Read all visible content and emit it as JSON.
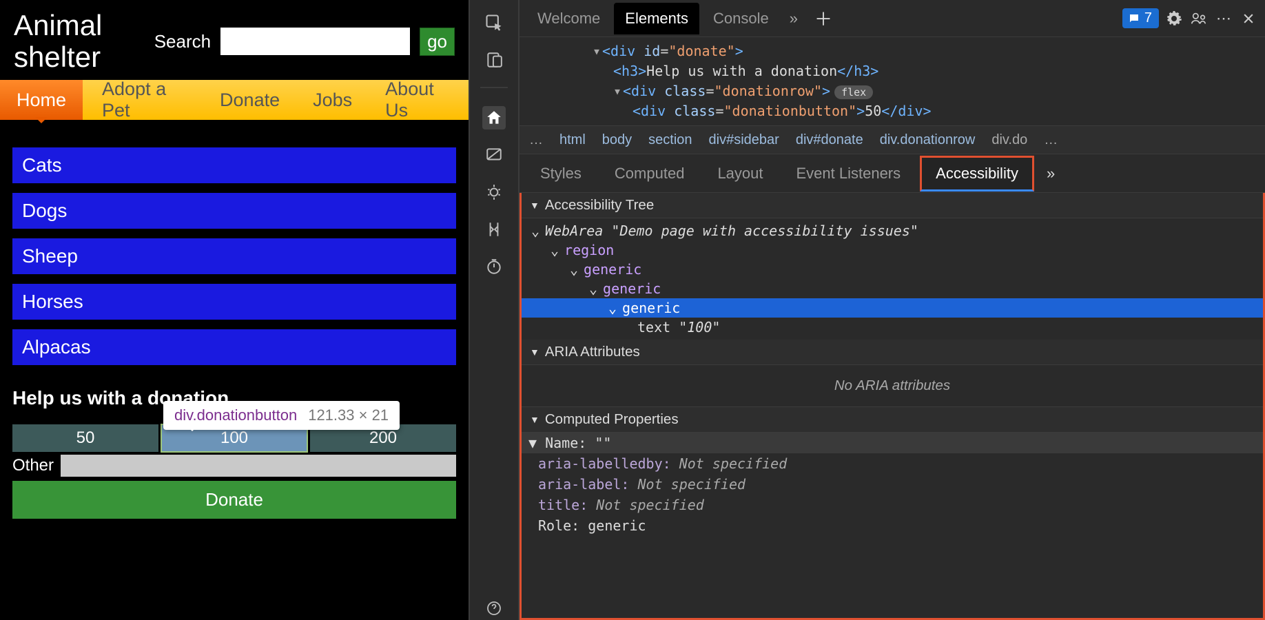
{
  "page": {
    "logo_line1": "Animal",
    "logo_line2": "shelter",
    "search_label": "Search",
    "go_label": "go",
    "nav": [
      "Home",
      "Adopt a Pet",
      "Donate",
      "Jobs",
      "About Us"
    ],
    "nav_active": 0,
    "sidebar": [
      "Cats",
      "Dogs",
      "Sheep",
      "Horses",
      "Alpacas"
    ],
    "donate_heading": "Help us with a donation",
    "donation_buttons": [
      "50",
      "100",
      "200"
    ],
    "other_label": "Other",
    "donate_button": "Donate"
  },
  "tooltip": {
    "selector_tag": "div",
    "selector_class": ".donationbutton",
    "dimensions": "121.33 × 21"
  },
  "devtools": {
    "tabs": [
      "Welcome",
      "Elements",
      "Console"
    ],
    "active_tab": 1,
    "issues_count": "7",
    "crumbs": [
      "html",
      "body",
      "section",
      "div#sidebar",
      "div#donate",
      "div.donationrow",
      "div.do"
    ],
    "subtabs": [
      "Styles",
      "Computed",
      "Layout",
      "Event Listeners",
      "Accessibility"
    ],
    "subtab_active": 4,
    "dom": {
      "line1_open": "<div id=\"donate\">",
      "line2": "<h3>Help us with a donation</h3>",
      "line3_open": "<div class=\"donationrow\">",
      "line3_badge": "flex",
      "line4": "<div class=\"donationbutton\">50</div>"
    },
    "a11y": {
      "tree_title": "Accessibility Tree",
      "webarea_label": "Demo page with accessibility issues",
      "nodes": [
        "WebArea",
        "region",
        "generic",
        "generic",
        "generic"
      ],
      "text_node": "100",
      "aria_title": "ARIA Attributes",
      "aria_empty": "No ARIA attributes",
      "computed_title": "Computed Properties",
      "props": [
        {
          "name": "Name:",
          "value": "\"\"",
          "head": true
        },
        {
          "name": "aria-labelledby:",
          "value": "Not specified"
        },
        {
          "name": "aria-label:",
          "value": "Not specified"
        },
        {
          "name": "title:",
          "value": "Not specified"
        },
        {
          "name": "Role:",
          "value": "generic",
          "plain": true
        }
      ]
    }
  }
}
